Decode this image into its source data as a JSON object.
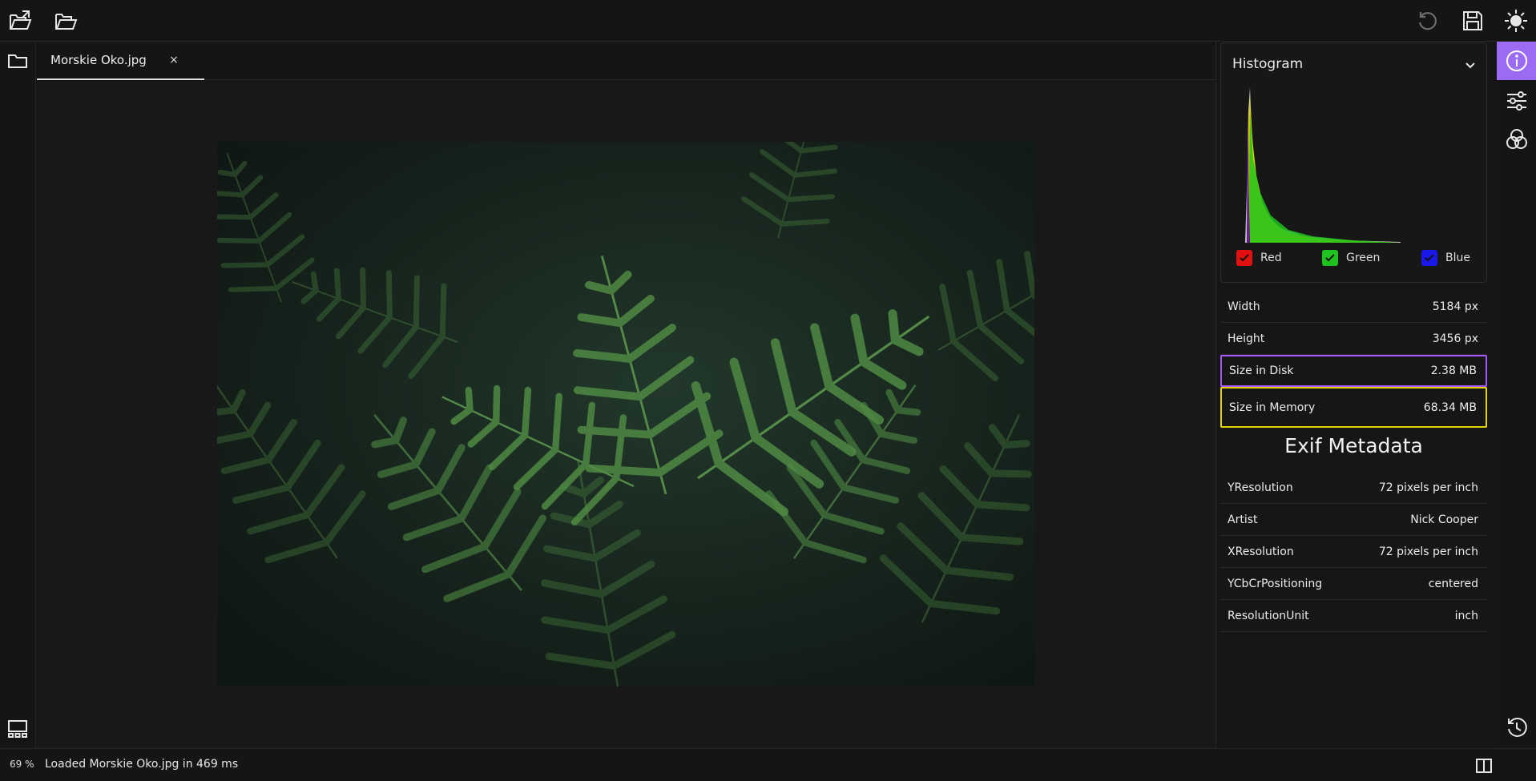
{
  "toolbar": {
    "open_external_icon": "open-external-icon",
    "open_folder_icon": "open-folder-icon",
    "undo_icon": "undo-icon",
    "save_icon": "save-icon",
    "theme_icon": "sun-icon"
  },
  "tabs": [
    {
      "label": "Morskie Oko.jpg",
      "close": "×"
    }
  ],
  "histogram": {
    "title": "Histogram",
    "channels": [
      {
        "label": "Red",
        "color": "#e01010",
        "checked": true
      },
      {
        "label": "Green",
        "color": "#1fc21f",
        "checked": true
      },
      {
        "label": "Blue",
        "color": "#1818e8",
        "checked": true
      }
    ]
  },
  "info": [
    {
      "label": "Width",
      "value": "5184 px"
    },
    {
      "label": "Height",
      "value": "3456 px"
    },
    {
      "label": "Size in Disk",
      "value": "2.38 MB"
    },
    {
      "label": "Size in Memory",
      "value": "68.34 MB"
    }
  ],
  "exif": {
    "title": "Exif Metadata",
    "rows": [
      {
        "label": "YResolution",
        "value": "72 pixels per inch"
      },
      {
        "label": "Artist",
        "value": "Nick Cooper"
      },
      {
        "label": "XResolution",
        "value": "72 pixels per inch"
      },
      {
        "label": "YCbCrPositioning",
        "value": "centered"
      },
      {
        "label": "ResolutionUnit",
        "value": "inch"
      }
    ]
  },
  "statusbar": {
    "zoom": "69 %",
    "message": "Loaded Morskie Oko.jpg in 469 ms"
  },
  "colors": {
    "accent": "#9b6cf2",
    "highlight_purple": "#a259ff",
    "highlight_yellow": "#e3d300"
  }
}
